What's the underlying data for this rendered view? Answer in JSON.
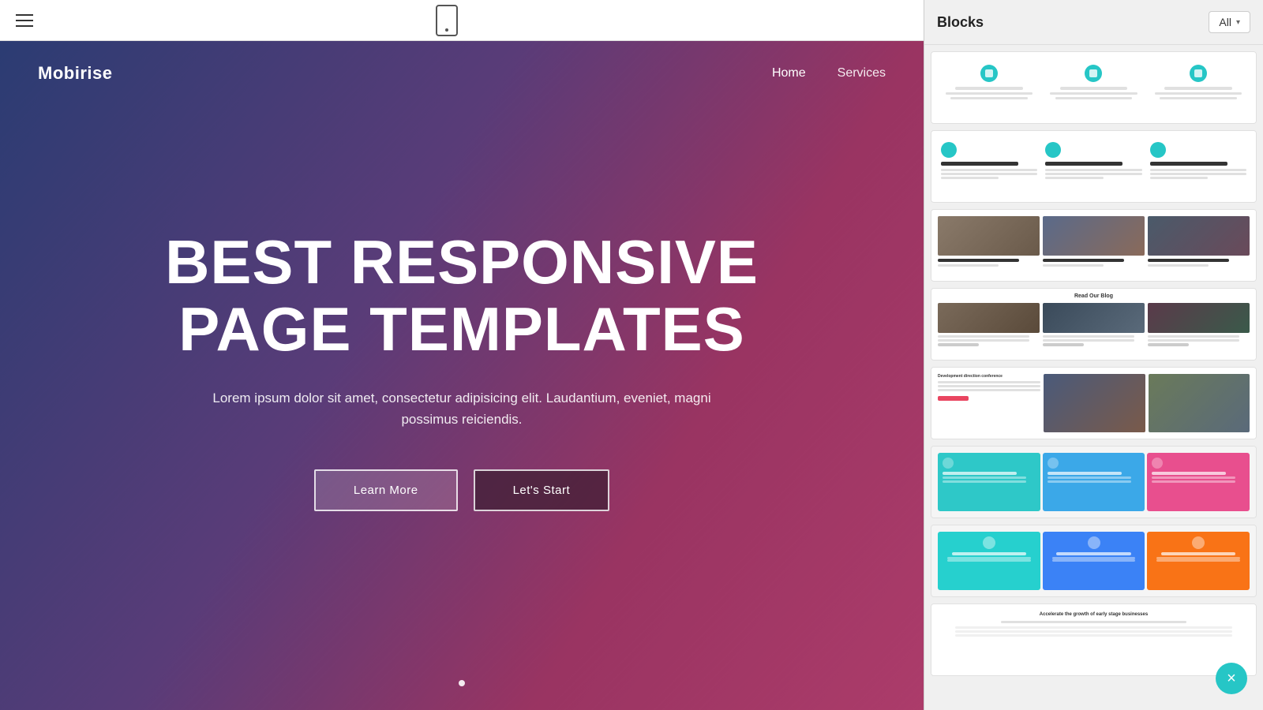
{
  "toolbar": {
    "hamburger_label": "Menu",
    "all_label": "All"
  },
  "blocks_panel": {
    "title": "Blocks",
    "filter": {
      "label": "All",
      "chevron": "▾"
    }
  },
  "preview": {
    "nav": {
      "brand": "Mobirise",
      "links": [
        {
          "label": "Home",
          "active": true
        },
        {
          "label": "Services",
          "active": false
        }
      ]
    },
    "hero": {
      "title_line1": "BEST RESPONSIVE",
      "title_line2": "PAGE TEMPLATES",
      "subtitle": "Lorem ipsum dolor sit amet, consectetur adipisicing elit. Laudantium, eveniet, magni possimus reiciendis.",
      "button_learn": "Learn More",
      "button_start": "Let's Start"
    }
  },
  "blocks": [
    {
      "id": "block-1",
      "type": "features-teal"
    },
    {
      "id": "block-2",
      "type": "features-circle"
    },
    {
      "id": "block-3",
      "type": "features-photos"
    },
    {
      "id": "block-4",
      "type": "blog-photos",
      "header": "Read Our Blog"
    },
    {
      "id": "block-5",
      "type": "conference"
    },
    {
      "id": "block-6",
      "type": "features-colored"
    },
    {
      "id": "block-7",
      "type": "features-colored-alt"
    },
    {
      "id": "block-8",
      "type": "startup"
    }
  ],
  "close_button": "×"
}
